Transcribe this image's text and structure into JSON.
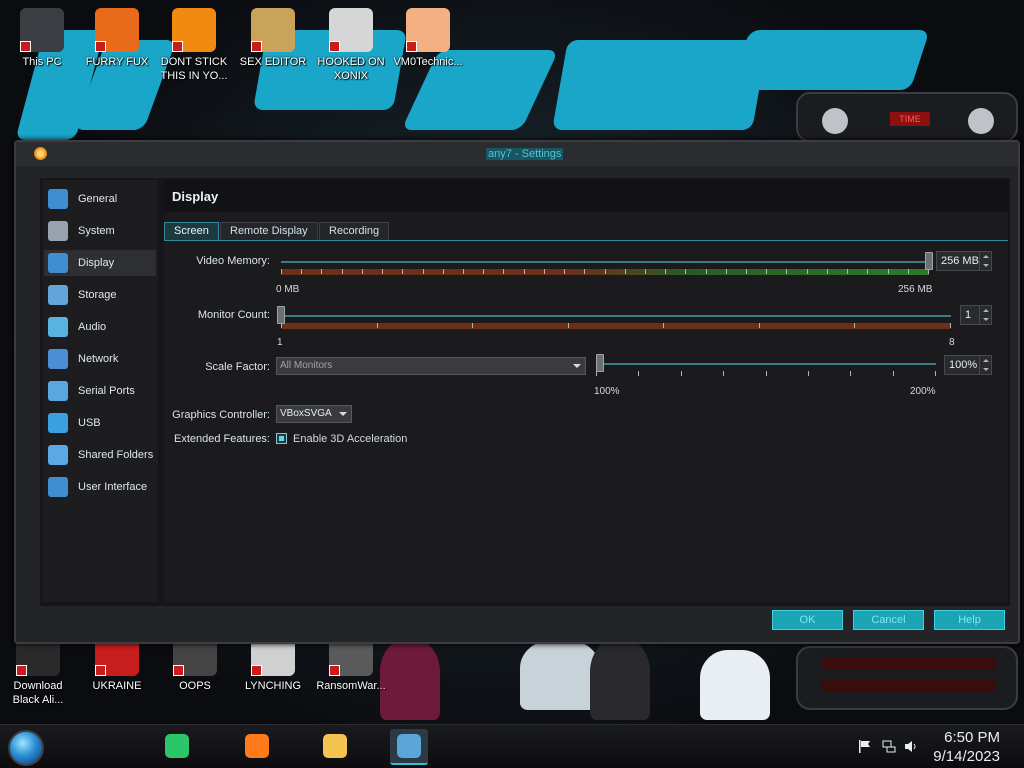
{
  "desktop": {
    "icons_top": [
      {
        "label": "This PC",
        "color": "#3b3d42"
      },
      {
        "label": "FURRY FUX",
        "color": "#e86a1a"
      },
      {
        "label": "DONT STICK THIS IN YO...",
        "color": "#f08a10"
      },
      {
        "label": "SEX EDITOR",
        "color": "#c9a35a"
      },
      {
        "label": "HOOKED ON XONIX",
        "color": "#d6d6d6"
      },
      {
        "label": "VM0Technic...",
        "color": "#f3b183"
      }
    ],
    "icons_bottom": [
      {
        "label": "Download Black Ali...",
        "color": "#2a2a2a"
      },
      {
        "label": "UKRAINE",
        "color": "#c81d1d"
      },
      {
        "label": "OOPS",
        "color": "#444"
      },
      {
        "label": "LYNCHING",
        "color": "#d0d0d0"
      },
      {
        "label": "RansomWar...",
        "color": "#5a5a5a"
      }
    ],
    "gadget_label": "TIME"
  },
  "window": {
    "title": "any7 - Settings",
    "sidebar": [
      {
        "label": "General",
        "icon": "monitor-icon"
      },
      {
        "label": "System",
        "icon": "chip-icon"
      },
      {
        "label": "Display",
        "icon": "display-icon",
        "selected": true
      },
      {
        "label": "Storage",
        "icon": "disk-icon"
      },
      {
        "label": "Audio",
        "icon": "speaker-icon"
      },
      {
        "label": "Network",
        "icon": "network-icon"
      },
      {
        "label": "Serial Ports",
        "icon": "serial-port-icon"
      },
      {
        "label": "USB",
        "icon": "usb-icon"
      },
      {
        "label": "Shared Folders",
        "icon": "folder-icon"
      },
      {
        "label": "User Interface",
        "icon": "window-icon"
      }
    ],
    "page_title": "Display",
    "tabs": [
      {
        "label": "Screen",
        "active": true
      },
      {
        "label": "Remote Display"
      },
      {
        "label": "Recording"
      }
    ],
    "screen": {
      "video_memory": {
        "label": "Video Memory:",
        "value": "256 MB",
        "min_label": "0 MB",
        "max_label": "256 MB",
        "level": 1.0
      },
      "monitor_count": {
        "label": "Monitor Count:",
        "value": "1",
        "min_label": "1",
        "max_label": "8",
        "level": 0.0
      },
      "scale_factor": {
        "label": "Scale Factor:",
        "combo_value": "All Monitors",
        "value": "100%",
        "min_label": "100%",
        "max_label": "200%",
        "level": 0.0
      },
      "graphics_controller": {
        "label": "Graphics Controller:",
        "value": "VBoxSVGA"
      },
      "extended_features": {
        "label": "Extended Features:",
        "checkbox_label": "Enable 3D Acceleration",
        "checked": true
      }
    },
    "buttons": {
      "ok": "OK",
      "cancel": "Cancel",
      "help": "Help"
    }
  },
  "taskbar": {
    "apps": [
      {
        "name": "notes-app-icon",
        "color": "#2cc66a"
      },
      {
        "name": "firefox-icon",
        "color": "#ff7b1a"
      },
      {
        "name": "file-explorer-icon",
        "color": "#f3c550"
      },
      {
        "name": "virtualbox-icon",
        "color": "#5aa6d8",
        "active": true
      }
    ],
    "time": "6:50 PM",
    "date": "9/14/2023"
  }
}
